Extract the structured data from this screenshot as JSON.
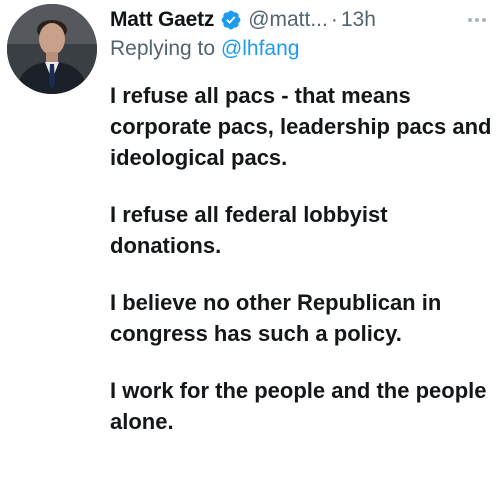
{
  "tweet": {
    "author": {
      "name": "Matt Gaetz",
      "handle": "@matt...",
      "verified": true,
      "verified_icon": "verified-badge-icon",
      "avatar_icon": "profile-photo"
    },
    "separator": "·",
    "time": "13h",
    "reply": {
      "prefix": "Replying to ",
      "to": "@lhfang"
    },
    "paragraphs": [
      "I refuse all pacs - that means corporate pacs, leadership pacs and ideological pacs.",
      "I refuse all federal lobbyist donations.",
      "I believe no other Republican in congress has such a policy.",
      "I work for the people and the people alone."
    ],
    "more_icon": "more-options-icon"
  },
  "colors": {
    "text": "#0f1419",
    "muted": "#536471",
    "link": "#1d9bf0",
    "verified": "#1d9bf0"
  }
}
